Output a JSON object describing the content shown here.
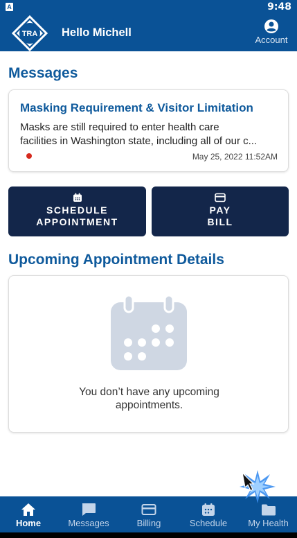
{
  "status_bar": {
    "indicator": "A",
    "time": "9:48"
  },
  "header": {
    "logo_text": "TRA",
    "greeting": "Hello Michell",
    "account_label": "Account",
    "account_icon": "account-circle-icon"
  },
  "messages": {
    "section_title": "Messages",
    "items": [
      {
        "title": "Masking Requirement & Visitor Limitation",
        "body_line1": "Masks are still required to enter health care",
        "body_line2": "facilities in Washington state, including all of our c...",
        "date": "May 25, 2022 11:52AM",
        "unread": true
      }
    ]
  },
  "actions": {
    "schedule": {
      "icon": "calendar-icon",
      "line1": "SCHEDULE",
      "line2": "APPOINTMENT"
    },
    "pay": {
      "icon": "credit-card-icon",
      "line1": "PAY",
      "line2": "BILL"
    }
  },
  "appointments": {
    "section_title": "Upcoming Appointment Details",
    "empty_line1": "You don’t have any upcoming",
    "empty_line2": "appointments."
  },
  "bottom_nav": {
    "active": "Home",
    "items": [
      {
        "label": "Home",
        "icon": "home-icon"
      },
      {
        "label": "Messages",
        "icon": "chat-icon"
      },
      {
        "label": "Billing",
        "icon": "credit-card-icon"
      },
      {
        "label": "Schedule",
        "icon": "calendar-icon"
      },
      {
        "label": "My Health",
        "icon": "folder-icon"
      }
    ]
  },
  "colors": {
    "brand_blue": "#0a5296",
    "title_blue": "#0f5a9c",
    "button_navy": "#13264a",
    "unread_red": "#d62a1e"
  }
}
